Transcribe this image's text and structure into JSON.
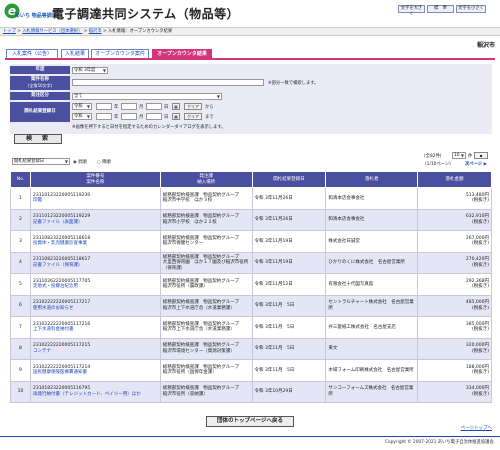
{
  "header": {
    "logo_e": "e",
    "logo_text": "あいち 物品等調達",
    "system_title": "電子調達共同システム（物品等）",
    "buttons": [
      "文字を大きく",
      "標　準",
      "文字を小さく"
    ]
  },
  "breadcrumb": {
    "items": [
      "トップ",
      "入札情報サービス（団体選択）",
      "稲沢市",
      "入札情報：オープンカウンタ結果"
    ],
    "separator": " > "
  },
  "city": "稲沢市",
  "tabs": [
    {
      "label": "入札案件（公告）",
      "active": false
    },
    {
      "label": "入札結果",
      "active": false
    },
    {
      "label": "オープンカウンタ案件",
      "active": false
    },
    {
      "label": "オープンカウンタ結果",
      "active": true
    }
  ],
  "search": {
    "fields": {
      "nendo_label": "年度",
      "nendo_value": "令和 3年度",
      "anken_label": "案件名称",
      "anken_sub": "(全角50文字)",
      "anken_value": "",
      "anken_note": "※部分一致で検索します。",
      "kubun_label": "発注区分",
      "kubun_value": "全て",
      "date_label": "開札結果登録日",
      "era": "令和",
      "year_suffix": "年",
      "month_suffix": "月",
      "day_suffix": "日",
      "clear_label": "クリア",
      "from_label": "から",
      "to_label": "まで",
      "calendar_note": "※画像を押下すると日付を指定するためのカレンダーダイアログを表示します。"
    },
    "button_label": "検　索"
  },
  "sort": {
    "value": "開札結果登録日",
    "asc_label": "昇順",
    "desc_label": "降順"
  },
  "pagination": {
    "total": "(全82件)",
    "per_page": "10",
    "per_page_suffix": "件",
    "page": "(1/10ページ)",
    "next": "次ページ",
    "next_arrow": "▶"
  },
  "table": {
    "headers": {
      "no": "No.",
      "anken": [
        "案件番号",
        "案件名称"
      ],
      "hacchu": [
        "発注課",
        "納入場所"
      ],
      "date": "開札結果登録日",
      "winner": "落札者",
      "amount": "落札金額"
    },
    "rows": [
      {
        "no": "1",
        "anken_no": "23110123220005119230",
        "anken_name": "印鑑",
        "dept": "総務部契約検査課　物品契約グループ",
        "place": "稲沢市中学校　ほか３校",
        "date": "令和 3年11月26日",
        "winner": "和清本店会事会社",
        "amount": "513,480円",
        "tax": "(税抜き)"
      },
      {
        "no": "2",
        "anken_no": "23110123220005119229",
        "anken_name": "記書ファイル（表面課）",
        "dept": "総務部契約検査課　物品契約グループ",
        "place": "稲沢市小学校　ほか２２校",
        "date": "令和 3年11月26日",
        "winner": "和清本店会事会社",
        "amount": "632,910円",
        "tax": "(税抜き)"
      },
      {
        "no": "3",
        "anken_no": "23110823220005118618",
        "anken_name": "投資体・乳児健康診査事業",
        "dept": "総務部契約検査課　物品契約グループ",
        "place": "稲沢市保健センター",
        "date": "令和 3年11月19日",
        "winner": "株式会社日誠堂",
        "amount": "267,000円",
        "tax": "(税抜き)"
      },
      {
        "no": "4",
        "anken_no": "23110823220005118617",
        "anken_name": "記書ファイル（保育課）",
        "dept": "総務部契約検査課　物品契約グループ",
        "place": "大里西保育園　ほか１７園及び稲沢市役所（保育課）",
        "date": "令和 3年11月19日",
        "winner": "ひかりのくに株式会社　名古屋営業所",
        "amount": "270,420円",
        "tax": "(税抜き)"
      },
      {
        "no": "5",
        "anken_no": "23110262220005117705",
        "anken_name": "走地式・投擲台紀念用",
        "dept": "総務部契約検査課　物品契約グループ",
        "place": "稲沢市役所（農政課）",
        "date": "令和 3年11月12日",
        "winner": "有限会社十代図写真館",
        "amount": "292,368円",
        "tax": "(税抜き)"
      },
      {
        "no": "6",
        "anken_no": "23102222220005117217",
        "anken_name": "使用水道のお知らせ",
        "dept": "総務部契約検査課　物品契約グループ",
        "place": "稲沢市上下水道庁舎（水道業務課）",
        "date": "令和 3年11月　5日",
        "winner": "セントラルチャート株式会社　名古屋営業所",
        "amount": "485,000円",
        "tax": "(税抜き)"
      },
      {
        "no": "7",
        "anken_no": "23102222220005117216",
        "anken_name": "上下水道料金納付書",
        "dept": "総務部契約検査課　物品契約グループ",
        "place": "稲沢市上下水道庁舎（水道業務課）",
        "date": "令和 3年11月　5日",
        "winner": "弁三菱紙工株式会社　名古屋支店",
        "amount": "385,000円",
        "tax": "(税抜き)"
      },
      {
        "no": "8",
        "anken_no": "23102222220005117215",
        "anken_name": "コンテナ",
        "dept": "総務部契約検査課　物品契約グループ",
        "place": "稲沢市環境センター（資源対策課）",
        "date": "令和 3年11月　5日",
        "winner": "東文",
        "amount": "320,000円",
        "tax": "(税抜き)"
      },
      {
        "no": "9",
        "anken_no": "23102222220005117214",
        "anken_name": "国民健康保険医療費通知書",
        "dept": "総務部契約検査課　物品契約グループ",
        "place": "稲沢市役所（国保年金課）",
        "date": "令和 3年11月　5日",
        "winner": "木場フォーム印刷株式会社　名古屋営業所",
        "amount": "188,000円",
        "tax": "(税抜き)"
      },
      {
        "no": "10",
        "anken_no": "23101823220005116795",
        "anken_name": "再発行納付書（テレジットカード、ペイジー用）ほか",
        "dept": "総務部契約検査課　物品契約グループ",
        "place": "稲沢市役所（収納課）",
        "date": "令和 3年10月29日",
        "winner": "サンコーフォームズ株式会社　名古屋営業所",
        "amount": "334,000円",
        "tax": "(税抜き)"
      }
    ]
  },
  "footer": {
    "top_page_button": "団体のトップページへ戻る",
    "page_top_link": "ページトップへ",
    "copyright": "Copyright © 2007-2021 あいち電子自治体推進協議会."
  },
  "colors": {
    "header_blue": "#4b4fa0",
    "active_tab": "#d3357a",
    "row_alt": "#e5e5f5",
    "panel": "#ebebf6"
  }
}
